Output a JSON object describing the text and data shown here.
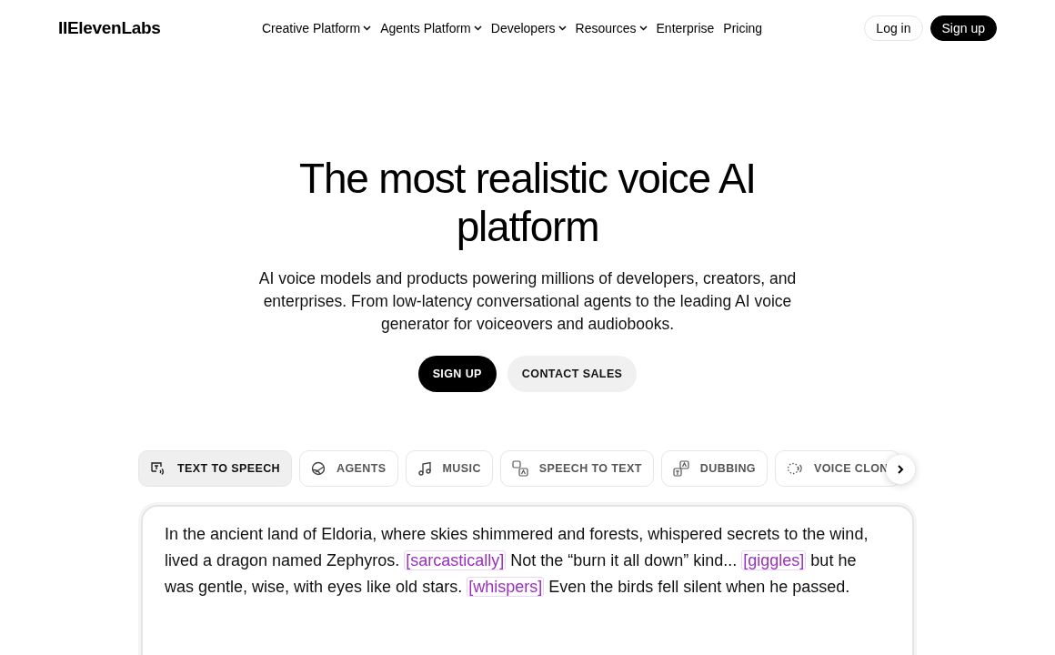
{
  "header": {
    "logo": "IIElevenLabs",
    "nav": [
      {
        "label": "Creative Platform",
        "kind": "menu"
      },
      {
        "label": "Agents Platform",
        "kind": "menu"
      },
      {
        "label": "Developers",
        "kind": "menu"
      },
      {
        "label": "Resources",
        "kind": "menu"
      },
      {
        "label": "Enterprise",
        "kind": "link"
      },
      {
        "label": "Pricing",
        "kind": "link"
      }
    ],
    "login": "Log in",
    "signup": "Sign up"
  },
  "hero": {
    "title": "The most realistic voice AI platform",
    "subtitle": "AI voice models and products powering millions of developers, creators, and enterprises. From low-latency conversational agents to the leading AI voice generator for voiceovers and audiobooks.",
    "buttons": [
      {
        "label": "SIGN UP",
        "kind": "primary"
      },
      {
        "label": "CONTACT SALES",
        "kind": "secondary"
      }
    ]
  },
  "tabs": [
    {
      "label": "TEXT TO SPEECH",
      "kind": "tts",
      "selected": true
    },
    {
      "label": "AGENTS",
      "kind": "agents",
      "selected": false
    },
    {
      "label": "MUSIC",
      "kind": "music",
      "selected": false
    },
    {
      "label": "SPEECH TO TEXT",
      "kind": "stt",
      "selected": false
    },
    {
      "label": "DUBBING",
      "kind": "dubbing",
      "selected": false
    },
    {
      "label": "VOICE CLON",
      "kind": "clone",
      "selected": false
    }
  ],
  "editor": {
    "segments": [
      {
        "kind": "text",
        "text": "In the ancient land of Eldoria, where skies shimmered and forests, whispered secrets to the wind, lived a dragon named Zephyros. "
      },
      {
        "kind": "tag",
        "text": "[sarcastically]"
      },
      {
        "kind": "text",
        "text": " Not the “burn it all down” kind... "
      },
      {
        "kind": "tag",
        "text": "[giggles]"
      },
      {
        "kind": "text",
        "text": " but he was gentle, wise, with eyes like old stars. "
      },
      {
        "kind": "tag",
        "text": "[whispers]"
      },
      {
        "kind": "text",
        "text": " Even the birds fell silent when he passed."
      }
    ]
  }
}
